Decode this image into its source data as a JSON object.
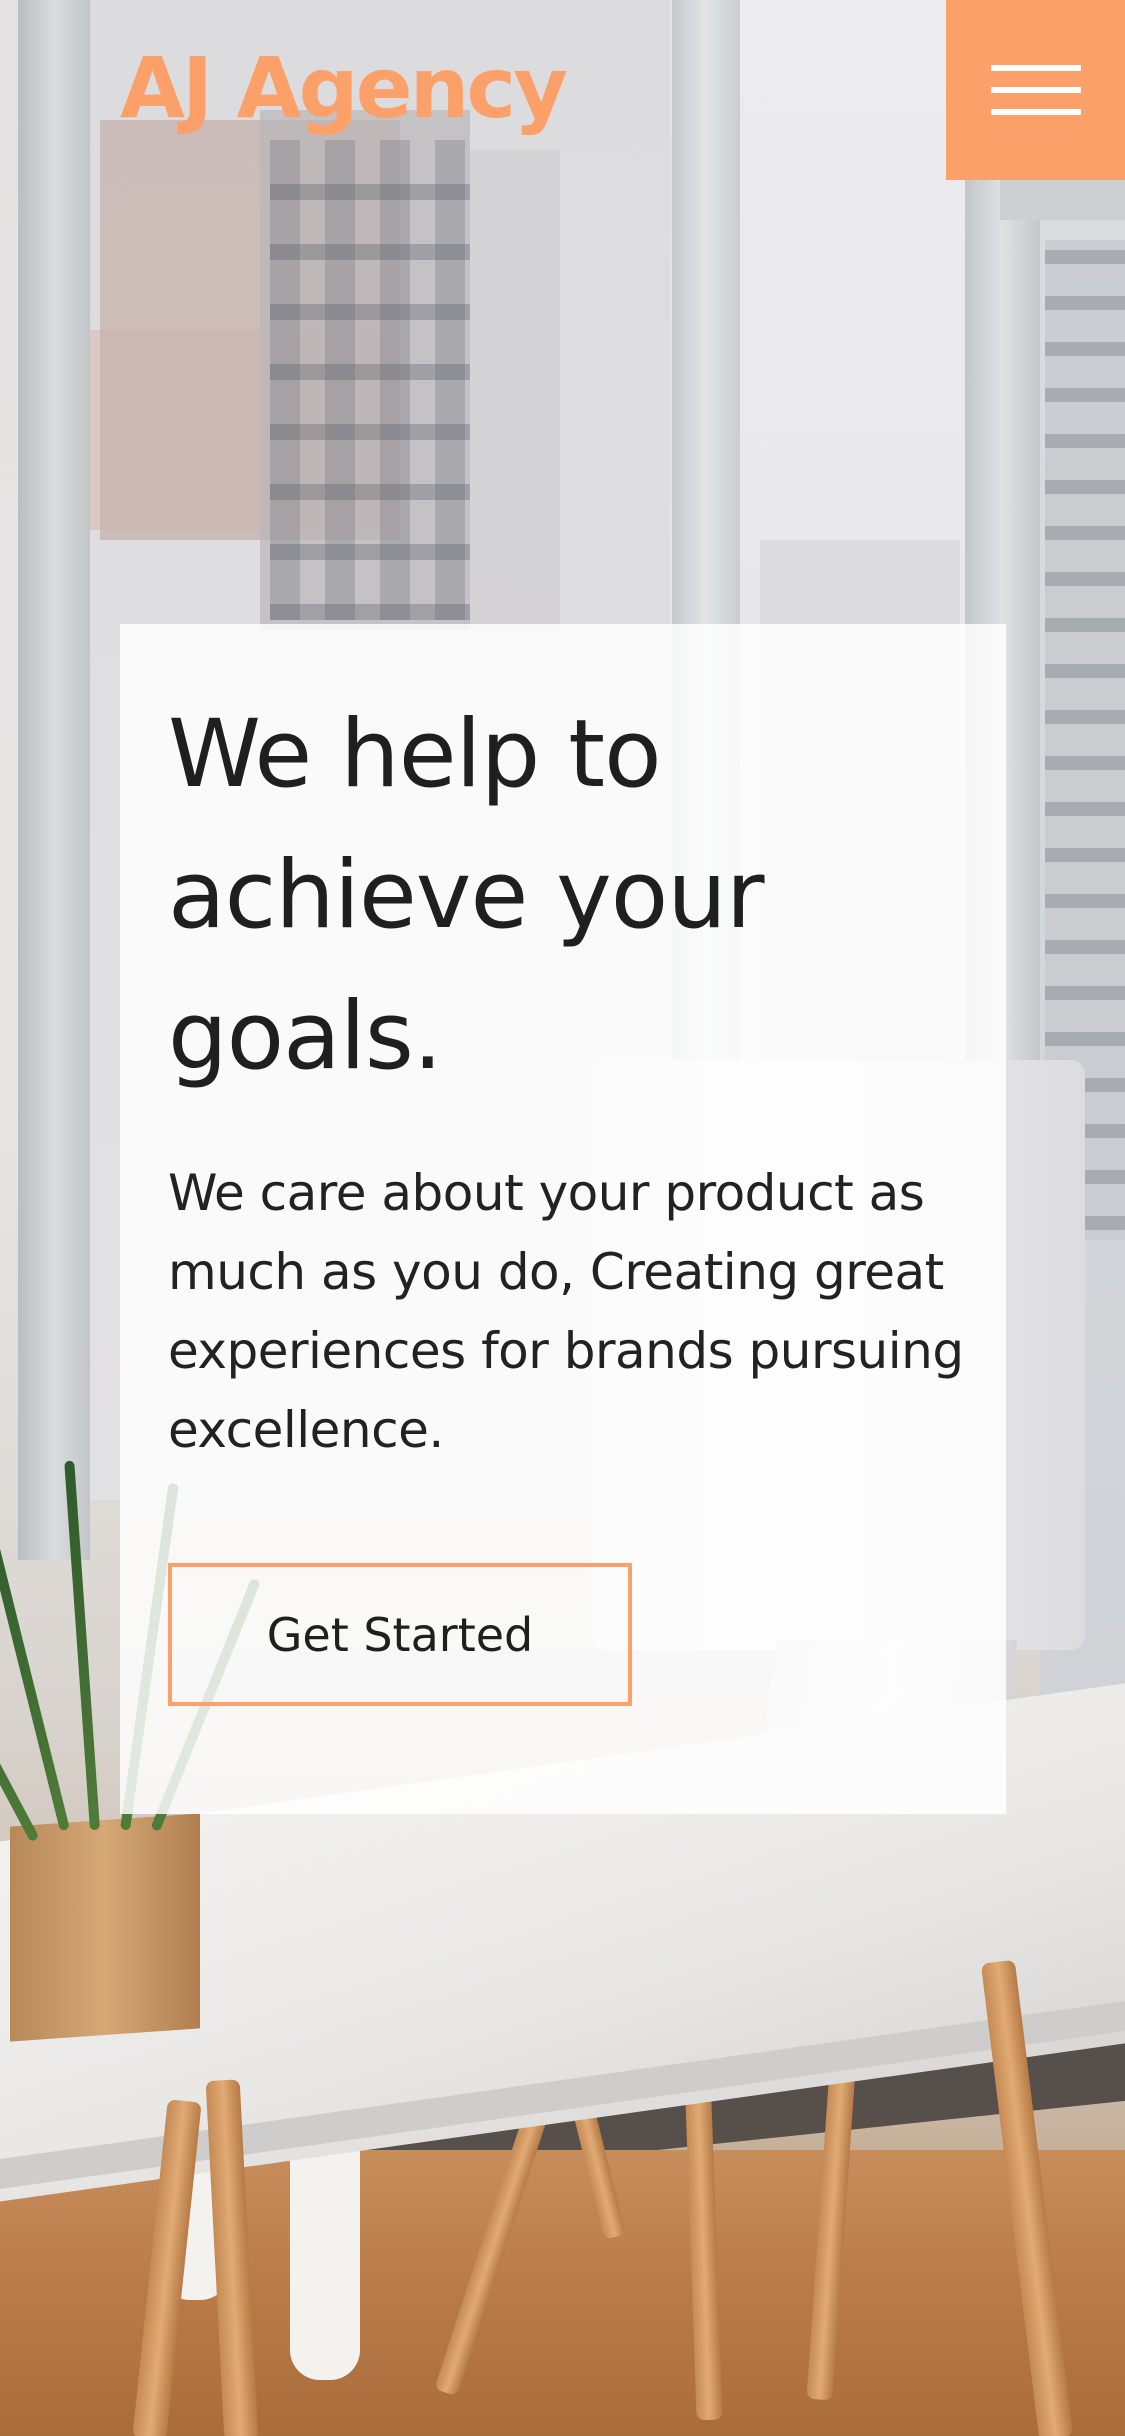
{
  "header": {
    "logo_text": "AJ Agency",
    "menu_icon": "hamburger-menu-icon"
  },
  "hero": {
    "title": "We help to achieve your goals.",
    "body": "We care about your product as much as you do, Creating great experiences for brands pursuing excellence.",
    "cta_label": "Get Started"
  },
  "colors": {
    "accent": "#fca06a",
    "text": "#1f1f1f",
    "card_background": "rgba(255,255,255,0.84)"
  }
}
